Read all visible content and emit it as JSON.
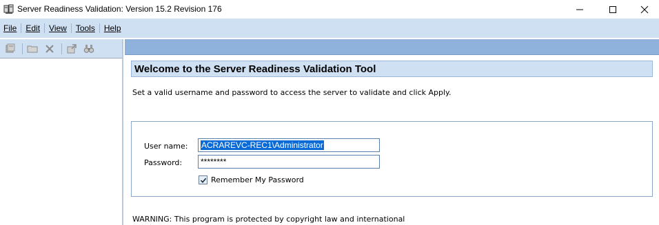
{
  "window": {
    "title": "Server Readiness Validation: Version 15.2 Revision 176",
    "controls": {
      "minimize": "minimize-icon",
      "maximize": "maximize-icon",
      "close": "close-icon"
    }
  },
  "menubar": {
    "items": [
      {
        "label": "File"
      },
      {
        "label": "Edit"
      },
      {
        "label": "View"
      },
      {
        "label": "Tools"
      },
      {
        "label": "Help"
      }
    ]
  },
  "left_toolbar": {
    "icons": [
      "server-icon",
      "folder-icon",
      "delete-icon",
      "properties-icon",
      "find-icon"
    ]
  },
  "main": {
    "welcome_title": "Welcome to the Server Readiness Validation Tool",
    "instructions": "Set a valid username and password to access the server to validate and click Apply.",
    "credentials": {
      "username_label": "User name:",
      "username_value": "ACRAREVC-REC1\\Administrator",
      "password_label": "Password:",
      "password_value": "********",
      "remember_label": "Remember My Password",
      "remember_checked": true
    },
    "warning": "WARNING: This program is protected by copyright law and international"
  },
  "colors": {
    "menubar_bg": "#cfe0f3",
    "header_strip": "#8fb2dd",
    "selection": "#0a6ad6"
  }
}
